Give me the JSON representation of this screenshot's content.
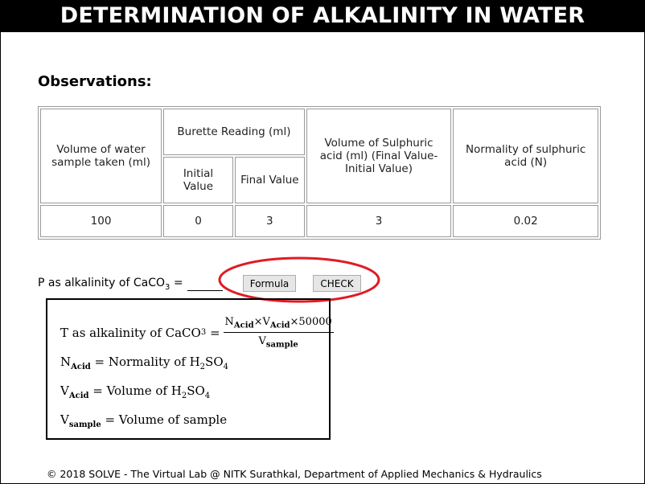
{
  "title": "DETERMINATION OF ALKALINITY IN WATER",
  "observations_heading": "Observations:",
  "table": {
    "col_volume_water": "Volume of water sample taken  (ml)",
    "col_burette_reading": "Burette Reading (ml)",
    "col_initial": "Initial Value",
    "col_final": "Final Value",
    "col_volume_acid": "Volume of Sulphuric acid (ml) (Final Value-Initial Value)",
    "col_normality": "Normality of sulphuric acid (N)",
    "row": {
      "volume_water": "100",
      "initial": "0",
      "final": "3",
      "volume_acid": "3",
      "normality": "0.02"
    }
  },
  "p_alkalinity": {
    "label_prefix": "P as alkalinity of CaCO",
    "label_sub": "3",
    "label_suffix": " = ",
    "answer": ""
  },
  "buttons": {
    "formula": "Formula",
    "check": "CHECK"
  },
  "highlight_color": "#e01b24",
  "formula_box": {
    "t_label": "T as alkalinity of CaCO",
    "t_sub": "3",
    "numerator_n": "N",
    "numerator_n_sub": "Acid",
    "numerator_v": "V",
    "numerator_v_sub": "Acid",
    "numerator_factor": "50000",
    "denominator_v": "V",
    "denominator_v_sub": "sample",
    "n_def_symbol": "N",
    "n_def_sub": "Acid",
    "n_def_text": " = Normality of H",
    "v_def_symbol": "V",
    "v_def_sub": "Acid",
    "v_def_text": " = Volume of H",
    "chem_2": "2",
    "chem_so": "SO",
    "chem_4": "4",
    "vs_def_symbol": "V",
    "vs_def_sub": "sample",
    "vs_def_text": " = Volume of sample"
  },
  "footer": "© 2018 SOLVE - The Virtual Lab @ NITK Surathkal, Department of Applied Mechanics & Hydraulics"
}
